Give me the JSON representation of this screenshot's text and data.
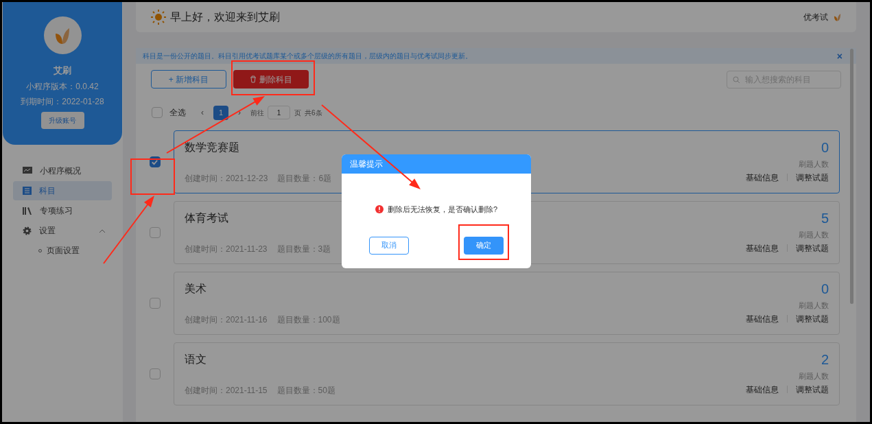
{
  "sidebar": {
    "app_name": "艾刷",
    "version": "小程序版本：0.0.42",
    "expiry": "到期时间：2022-01-28",
    "upgrade_button": "升级账号",
    "nav": [
      {
        "label": "小程序概况",
        "selected": false
      },
      {
        "label": "科目",
        "selected": true
      },
      {
        "label": "专项练习",
        "selected": false
      },
      {
        "label": "设置",
        "selected": false,
        "expanded": true,
        "children": [
          {
            "label": "页面设置",
            "selected": false
          }
        ]
      }
    ]
  },
  "header": {
    "greeting": "早上好，欢迎来到艾刷",
    "user": "优考试"
  },
  "notice": {
    "text": "科目是一份公开的题目。科目引用优考试题库某个或多个层级的所有题目，层级内的题目与优考试同步更新。",
    "close": "×"
  },
  "toolbar": {
    "add_button": "+ 新增科目",
    "delete_button": "删除科目",
    "search_placeholder": "输入想搜索的科目"
  },
  "pagination": {
    "select_all": {
      "label": "全选",
      "checked": false
    },
    "prev": "‹",
    "pages": [
      {
        "label": "1",
        "selected": true
      }
    ],
    "next": "›",
    "goto_label": "前往",
    "goto_value": "1",
    "page_unit": "页",
    "total": "共6条"
  },
  "subjects": [
    {
      "title": "数学竞赛题",
      "created": "创建时间：2021-12-23",
      "count": "题目数量：6题",
      "users": "0",
      "users_label": "刷题人数",
      "actions": [
        "基础信息",
        "调整试题"
      ],
      "checked": true,
      "selected": true
    },
    {
      "title": "体育考试",
      "created": "创建时间：2021-11-23",
      "count": "题目数量：3题",
      "users": "5",
      "users_label": "刷题人数",
      "actions": [
        "基础信息",
        "调整试题"
      ],
      "checked": false,
      "selected": false
    },
    {
      "title": "美术",
      "created": "创建时间：2021-11-16",
      "count": "题目数量：100题",
      "users": "0",
      "users_label": "刷题人数",
      "actions": [
        "基础信息",
        "调整试题"
      ],
      "checked": false,
      "selected": false
    },
    {
      "title": "语文",
      "created": "创建时间：2021-11-15",
      "count": "题目数量：50题",
      "users": "2",
      "users_label": "刷题人数",
      "actions": [
        "基础信息",
        "调整试题"
      ],
      "checked": false,
      "selected": false
    }
  ],
  "dialog": {
    "title": "温馨提示",
    "message": "删除后无法恢复，是否确认删除?",
    "cancel": "取消",
    "confirm": "确定"
  }
}
